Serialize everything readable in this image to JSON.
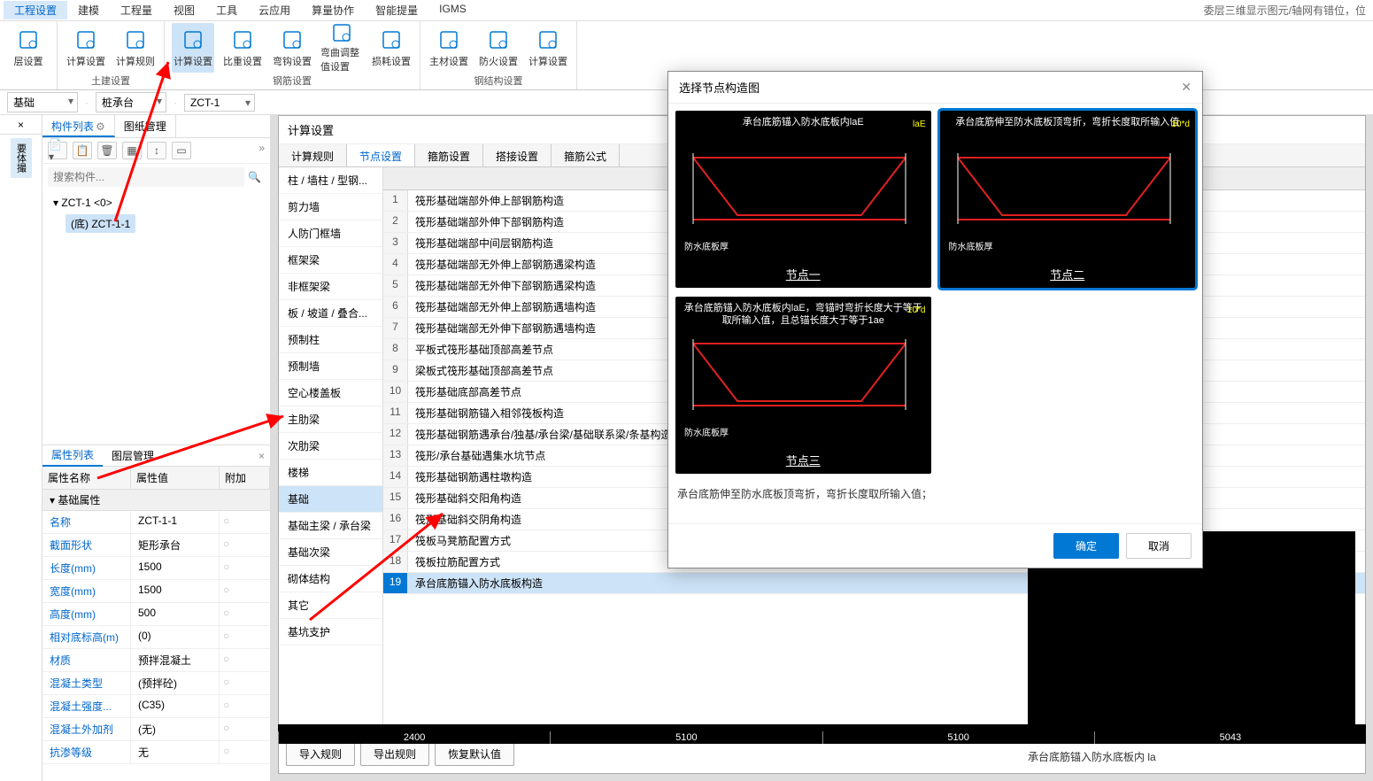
{
  "menubar": {
    "items": [
      "工程设置",
      "建模",
      "工程量",
      "视图",
      "工具",
      "云应用",
      "算量协作",
      "智能提量",
      "IGMS"
    ],
    "active": 0,
    "rightmsg": "委层三维显示图元/轴网有错位，位"
  },
  "ribbon": {
    "groups": [
      {
        "label": "",
        "btns": [
          {
            "lbl": "层设置"
          }
        ]
      },
      {
        "label": "土建设置",
        "btns": [
          {
            "lbl": "计算设置"
          },
          {
            "lbl": "计算规则"
          }
        ]
      },
      {
        "label": "钢筋设置",
        "btns": [
          {
            "lbl": "计算设置",
            "sel": true
          },
          {
            "lbl": "比重设置"
          },
          {
            "lbl": "弯钩设置"
          },
          {
            "lbl": "弯曲调整值设置"
          },
          {
            "lbl": "损耗设置"
          }
        ]
      },
      {
        "label": "钢结构设置",
        "btns": [
          {
            "lbl": "主材设置"
          },
          {
            "lbl": "防火设置"
          },
          {
            "lbl": "计算设置"
          }
        ]
      }
    ]
  },
  "subbar": {
    "a": "基础",
    "b": "桩承台",
    "c": "ZCT-1"
  },
  "side": {
    "tabs": [
      "构件列表",
      "图纸管理"
    ],
    "searchPlaceholder": "搜索构件...",
    "tree": {
      "root": "ZCT-1  <0>",
      "leaf": "(底) ZCT-1-1"
    },
    "propTabs": [
      "属性列表",
      "图层管理"
    ],
    "propHdr": [
      "属性名称",
      "属性值",
      "附加"
    ],
    "propSection": "基础属性",
    "props": [
      {
        "k": "名称",
        "v": "ZCT-1-1"
      },
      {
        "k": "截面形状",
        "v": "矩形承台"
      },
      {
        "k": "长度(mm)",
        "v": "1500"
      },
      {
        "k": "宽度(mm)",
        "v": "1500"
      },
      {
        "k": "高度(mm)",
        "v": "500"
      },
      {
        "k": "相对底标高(m)",
        "v": "(0)"
      },
      {
        "k": "材质",
        "v": "预拌混凝土"
      },
      {
        "k": "混凝土类型",
        "v": "(预拌砼)"
      },
      {
        "k": "混凝土强度...",
        "v": "(C35)"
      },
      {
        "k": "混凝土外加剂",
        "v": "(无)"
      },
      {
        "k": "抗渗等级",
        "v": "无"
      }
    ]
  },
  "calc": {
    "title": "计算设置",
    "tabs": [
      "计算规则",
      "节点设置",
      "箍筋设置",
      "搭接设置",
      "箍筋公式"
    ],
    "activeTab": 1,
    "cats": [
      "柱 / 墙柱 / 型钢...",
      "剪力墙",
      "人防门框墙",
      "框架梁",
      "非框架梁",
      "板 / 坡道 / 叠合...",
      "预制柱",
      "预制墙",
      "空心楼盖板",
      "主肋梁",
      "次肋梁",
      "楼梯",
      "基础",
      "基础主梁 / 承台梁",
      "基础次梁",
      "砌体结构",
      "其它",
      "基坑支护"
    ],
    "selCat": 12,
    "ruleHdr": "名称",
    "rules": [
      "筏形基础端部外伸上部钢筋构造",
      "筏形基础端部外伸下部钢筋构造",
      "筏形基础端部中间层钢筋构造",
      "筏形基础端部无外伸上部钢筋遇梁构造",
      "筏形基础端部无外伸下部钢筋遇梁构造",
      "筏形基础端部无外伸上部钢筋遇墙构造",
      "筏形基础端部无外伸下部钢筋遇墙构造",
      "平板式筏形基础顶部高差节点",
      "梁板式筏形基础顶部高差节点",
      "筏形基础底部高差节点",
      "筏形基础钢筋锚入相邻筏板构造",
      "筏形基础钢筋遇承台/独基/承台梁/基础联系梁/条基构造",
      "筏形/承台基础遇集水坑节点",
      "筏形基础钢筋遇柱墩构造",
      "筏形基础斜交阳角构造",
      "筏形基础斜交阴角构造",
      "筏板马凳筋配置方式",
      "筏板拉筋配置方式",
      "承台底筋锚入防水底板构造"
    ],
    "selRule": 18,
    "foot": [
      "导入规则",
      "导出规则",
      "恢复默认值"
    ],
    "ruler": [
      "2400",
      "5100",
      "5100",
      "5043"
    ],
    "underCaption": "承台底筋锚入防水底板内 la"
  },
  "modal": {
    "title": "选择节点构造图",
    "thumbs": [
      {
        "title": "承台底筋锚入防水底板内laE",
        "corner": "laE",
        "label": "节点一",
        "side": "防水底板厚"
      },
      {
        "title": "承台底筋伸至防水底板顶弯折，弯折长度取所输入值",
        "corner": "10*d",
        "label": "节点二",
        "side": "防水底板厚",
        "sel": true
      },
      {
        "title": "承台底筋锚入防水底板内laE，弯锚时弯折长度大于等于取所输入值，且总锚长度大于等于1ae",
        "corner": "10*d",
        "label": "节点三",
        "side": "防水底板厚"
      }
    ],
    "desc": "承台底筋伸至防水底板顶弯折，弯折长度取所输入值；",
    "ok": "确定",
    "cancel": "取消"
  }
}
